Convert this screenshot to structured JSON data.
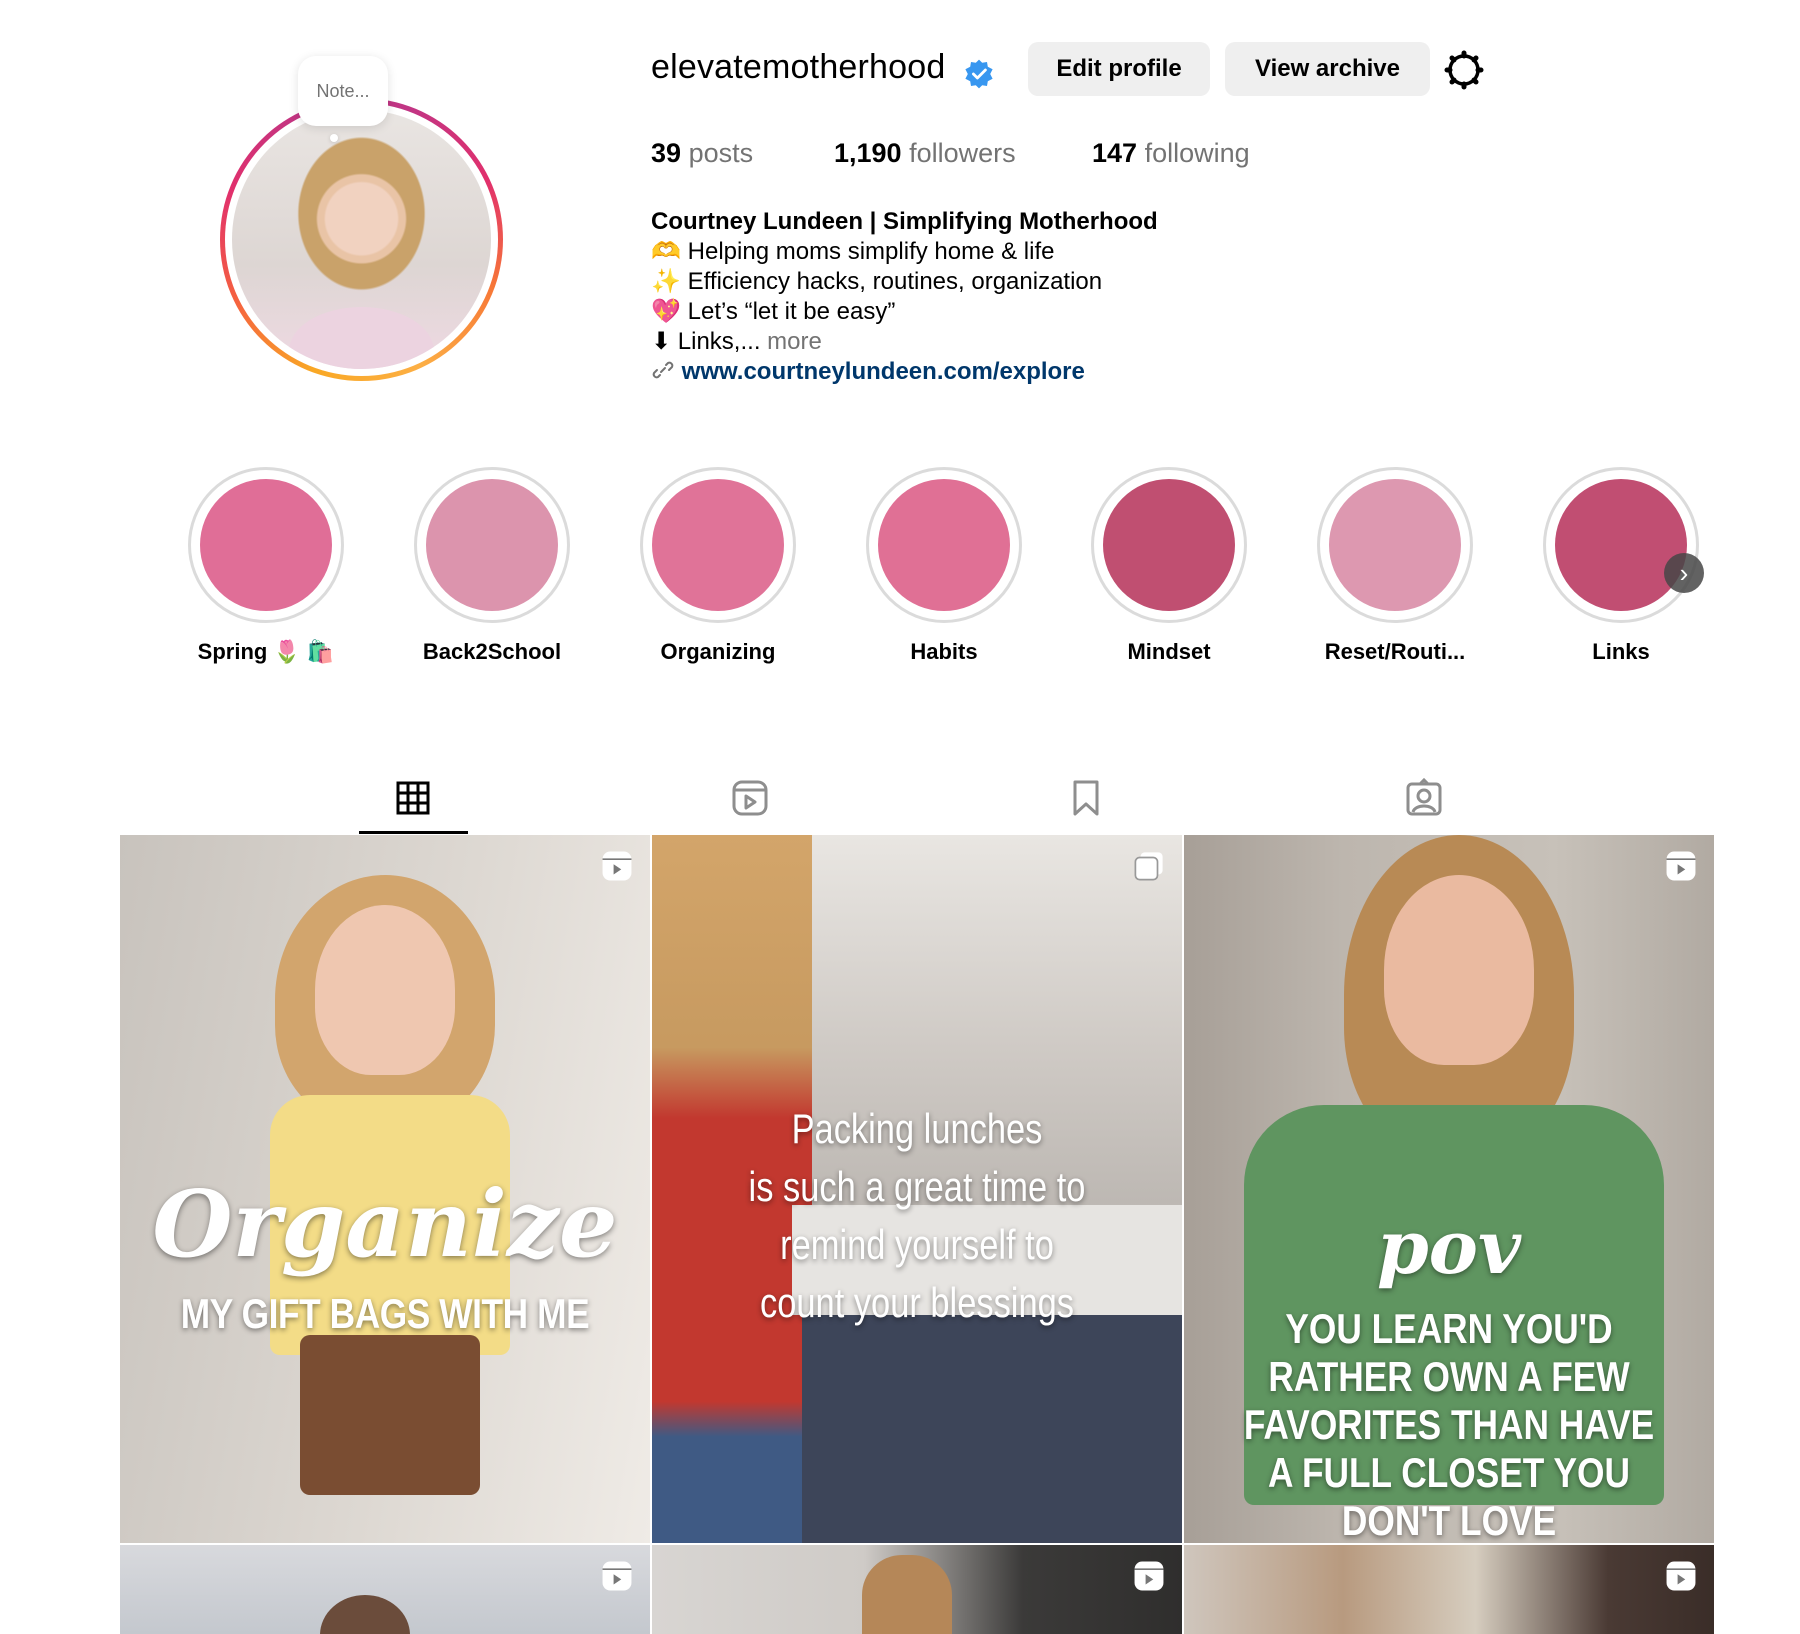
{
  "profile": {
    "username": "elevatemotherhood",
    "note_placeholder": "Note...",
    "edit_profile_label": "Edit profile",
    "view_archive_label": "View archive",
    "stats": {
      "posts_count": "39",
      "posts_label": "posts",
      "followers_count": "1,190",
      "followers_label": "followers",
      "following_count": "147",
      "following_label": "following"
    },
    "bio": {
      "name": "Courtney Lundeen | Simplifying Motherhood",
      "line1_emoji": "🫶",
      "line1": "Helping moms simplify home & life",
      "line2_emoji": "✨",
      "line2": "Efficiency hacks, routines, organization",
      "line3_emoji": "💖",
      "line3": "Let’s “let it be easy”",
      "line4_emoji": "⬇",
      "line4": "Links,...",
      "more": "more",
      "link": "www.courtneylundeen.com/explore"
    },
    "colors": {
      "verified": "#3897f0",
      "link": "#00376b",
      "muted": "#737373"
    }
  },
  "highlights": [
    {
      "label": "Spring 🌷 🛍️",
      "color": "#e06e97"
    },
    {
      "label": "Back2School",
      "color": "#dc94ad"
    },
    {
      "label": "Organizing",
      "color": "#e07398"
    },
    {
      "label": "Habits",
      "color": "#e07095"
    },
    {
      "label": "Mindset",
      "color": "#c04f71"
    },
    {
      "label": "Reset/Routi...",
      "color": "#dd98b0"
    },
    {
      "label": "Links",
      "color": "#c14e72"
    }
  ],
  "tabs": [
    "posts-grid-icon",
    "reels-icon",
    "saved-icon",
    "tagged-icon"
  ],
  "posts": [
    {
      "type": "reel",
      "script": "Organize",
      "caption": "MY GIFT BAGS WITH ME"
    },
    {
      "type": "carousel",
      "caption_lines": [
        "Packing lunches",
        "is such a great time to",
        "remind yourself to",
        "count your blessings"
      ]
    },
    {
      "type": "reel",
      "script": "pov",
      "caption_lines": [
        "YOU LEARN YOU'D",
        "RATHER OWN A FEW",
        "FAVORITES THAN HAVE",
        "A FULL CLOSET YOU",
        "DON'T LOVE"
      ]
    },
    {
      "type": "reel"
    },
    {
      "type": "reel"
    },
    {
      "type": "reel"
    }
  ]
}
